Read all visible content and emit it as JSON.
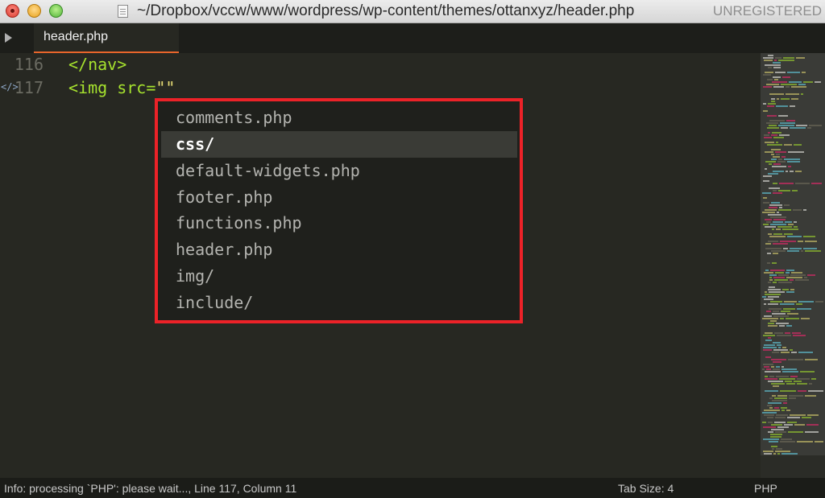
{
  "window": {
    "title": "~/Dropbox/vccw/www/wordpress/wp-content/themes/ottanxyz/header.php",
    "license": "UNREGISTERED"
  },
  "tabs": [
    {
      "label": "header.php",
      "active": true
    }
  ],
  "editor": {
    "lines": [
      {
        "number": "116",
        "tokens": {
          "t1": "</nav>"
        }
      },
      {
        "number": "117",
        "tokens": {
          "t1": "<img",
          "t2": " src=",
          "t3": "\"\""
        }
      }
    ]
  },
  "autocomplete": {
    "items": [
      {
        "label": "comments.php",
        "selected": false
      },
      {
        "label": "css/",
        "selected": true
      },
      {
        "label": "default-widgets.php",
        "selected": false
      },
      {
        "label": "footer.php",
        "selected": false
      },
      {
        "label": "functions.php",
        "selected": false
      },
      {
        "label": "header.php",
        "selected": false
      },
      {
        "label": "img/",
        "selected": false
      },
      {
        "label": "include/",
        "selected": false
      }
    ]
  },
  "statusbar": {
    "info": "Info: processing `PHP': please wait..., Line 117, Column 11",
    "tab_size": "Tab Size: 4",
    "syntax": "PHP"
  },
  "colors": {
    "highlight_border": "#ec2228",
    "tab_accent": "#e8652b",
    "editor_bg": "#272822"
  }
}
